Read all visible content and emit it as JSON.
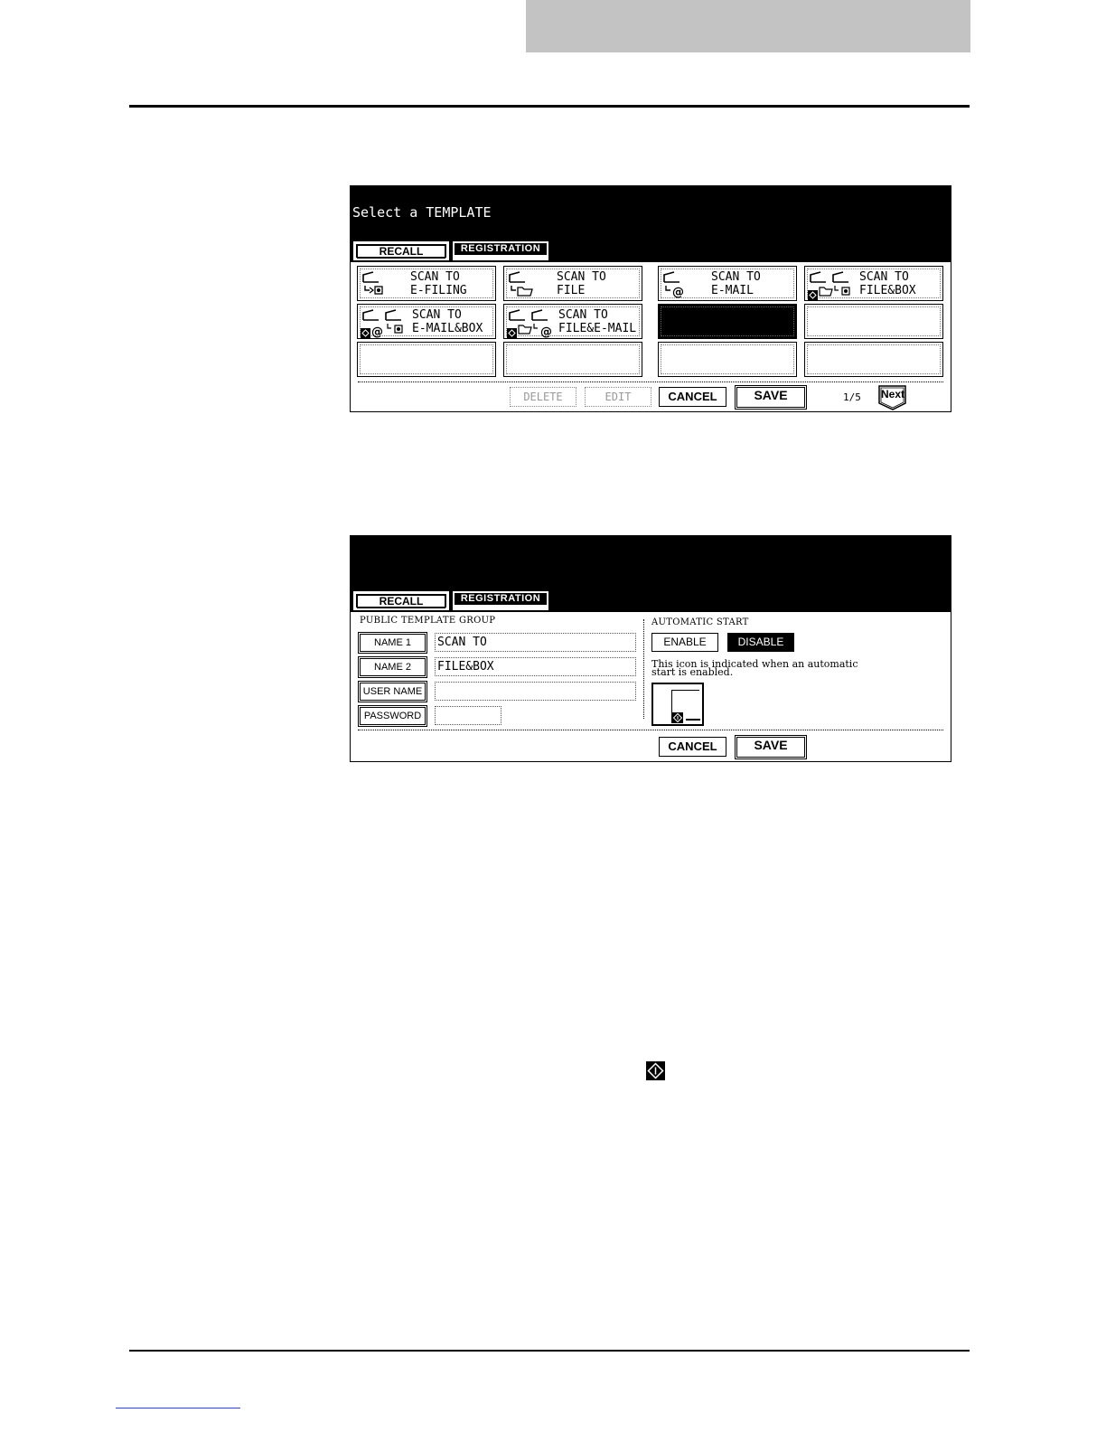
{
  "screen1": {
    "title": "Select a TEMPLATE",
    "tabs": {
      "recall": "RECALL",
      "registration": "REGISTRATION"
    },
    "templates": [
      {
        "line1": "SCAN TO",
        "line2": "E-FILING",
        "icon": "scan-to-efiling-icon"
      },
      {
        "line1": "SCAN TO",
        "line2": "FILE",
        "icon": "scan-to-file-icon"
      },
      {
        "line1": "SCAN TO",
        "line2": "E-MAIL",
        "icon": "scan-to-email-icon"
      },
      {
        "line1": "SCAN TO",
        "line2": "FILE&BOX",
        "icon": "scan-to-file-box-icon"
      },
      {
        "line1": "SCAN TO",
        "line2": "E-MAIL&BOX",
        "icon": "scan-to-email-box-icon"
      },
      {
        "line1": "SCAN TO",
        "line2": "FILE&E-MAIL",
        "icon": "scan-to-file-email-icon"
      },
      {
        "line1": "",
        "line2": "",
        "selected": true
      },
      {
        "line1": "",
        "line2": ""
      },
      {
        "line1": "",
        "line2": ""
      },
      {
        "line1": "",
        "line2": ""
      },
      {
        "line1": "",
        "line2": ""
      },
      {
        "line1": "",
        "line2": ""
      }
    ],
    "buttons": {
      "delete": "DELETE",
      "edit": "EDIT",
      "cancel": "CANCEL",
      "save": "SAVE"
    },
    "pager": "1/5",
    "next": "Next"
  },
  "screen2": {
    "title": "",
    "tabs": {
      "recall": "RECALL",
      "registration": "REGISTRATION"
    },
    "group_label": "PUBLIC TEMPLATE GROUP",
    "fields": {
      "name1": {
        "label": "NAME 1",
        "value": "SCAN TO"
      },
      "name2": {
        "label": "NAME 2",
        "value": "FILE&BOX"
      },
      "user_name": {
        "label": "USER NAME",
        "value": ""
      },
      "password": {
        "label": "PASSWORD",
        "value": ""
      }
    },
    "automatic_start": {
      "label": "AUTOMATIC START",
      "enable": "ENABLE",
      "disable": "DISABLE",
      "selected": "DISABLE",
      "note_line1": "This icon is indicated when an automatic",
      "note_line2": "start is enabled."
    },
    "buttons": {
      "cancel": "CANCEL",
      "save": "SAVE"
    }
  },
  "colors": {
    "header": "#000000",
    "band": "#c3c3c3",
    "link_rule": "#3344bb"
  }
}
